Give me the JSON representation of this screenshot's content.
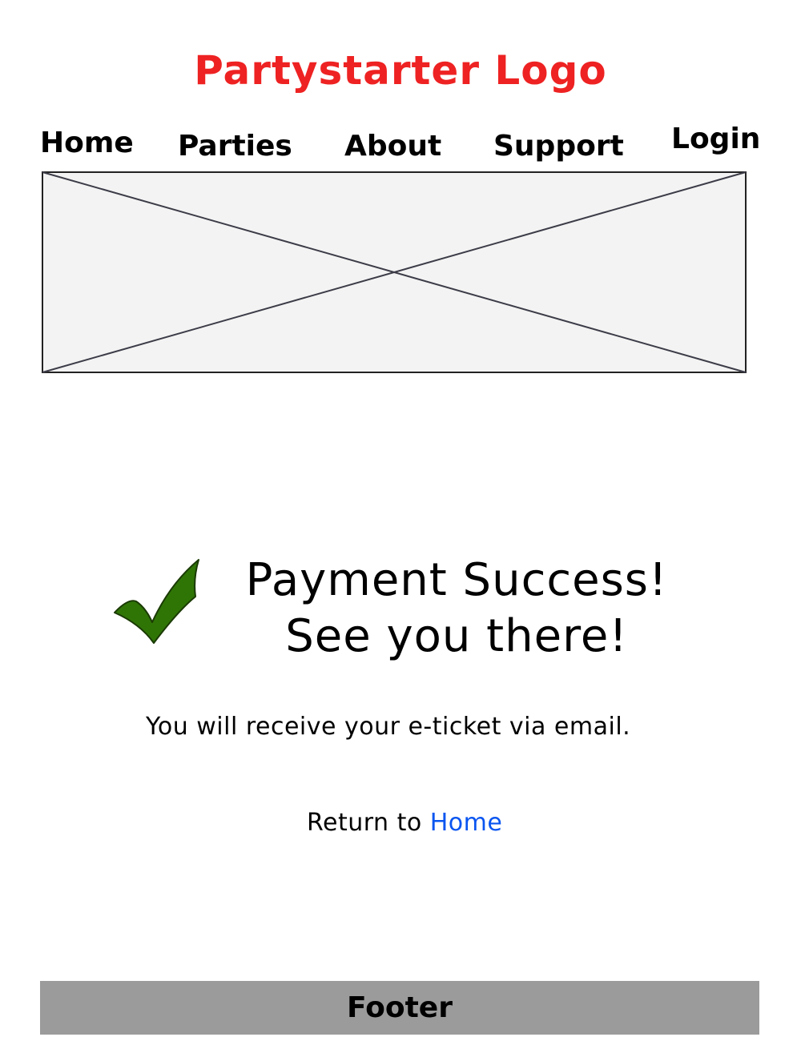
{
  "header": {
    "logo_text": "Partystarter Logo"
  },
  "nav": {
    "home": "Home",
    "parties": "Parties",
    "about": "About",
    "support": "Support",
    "login": "Login"
  },
  "hero": {
    "image_icon": "image-placeholder-icon"
  },
  "confirmation": {
    "icon": "checkmark-icon",
    "title_line1": "Payment Success!",
    "title_line2": "See you there!",
    "email_message": "You will receive your e-ticket via email.",
    "return_prefix": "Return to",
    "return_link": "Home"
  },
  "footer": {
    "label": "Footer"
  },
  "colors": {
    "logo": "#ee2222",
    "link": "#0a55f0",
    "check_fill": "#2f7506",
    "footer_bg": "#9b9b9b"
  }
}
